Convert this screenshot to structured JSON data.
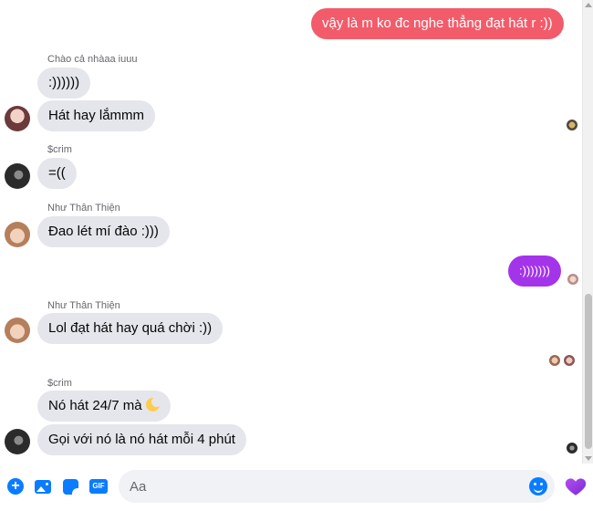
{
  "messages": {
    "m1": "vậy là m ko đc nghe thẳng đạt hát r :))",
    "m2_sender": "Chào cả nhàaa iuuu",
    "m2": ":))))))",
    "m3": "Hát hay lắmmm",
    "m4_sender": "$crim",
    "m4": "=((",
    "m5_sender": "Như Thân Thiện",
    "m5": "Đao lét mí đào :)))",
    "m6": ":)))))))",
    "m7_sender": "Như Thân Thiện",
    "m7": "Lol đạt hát hay quá chời :))",
    "m8_sender": "$crim",
    "m8": "Nó hát 24/7 mà",
    "m9": "Gọi với nó là nó hát mỗi 4 phút"
  },
  "composer": {
    "placeholder": "Aa",
    "gif_label": "GIF"
  },
  "colors": {
    "accent": "#0a7cff",
    "outgoing_red": "#f25c6a",
    "outgoing_purple": "#a434ea",
    "incoming": "#e4e6eb"
  },
  "icons": [
    "plus-circle-icon",
    "photo-icon",
    "sticker-icon",
    "gif-icon",
    "emoji-icon",
    "heart-icon",
    "moon-emoji-icon"
  ]
}
